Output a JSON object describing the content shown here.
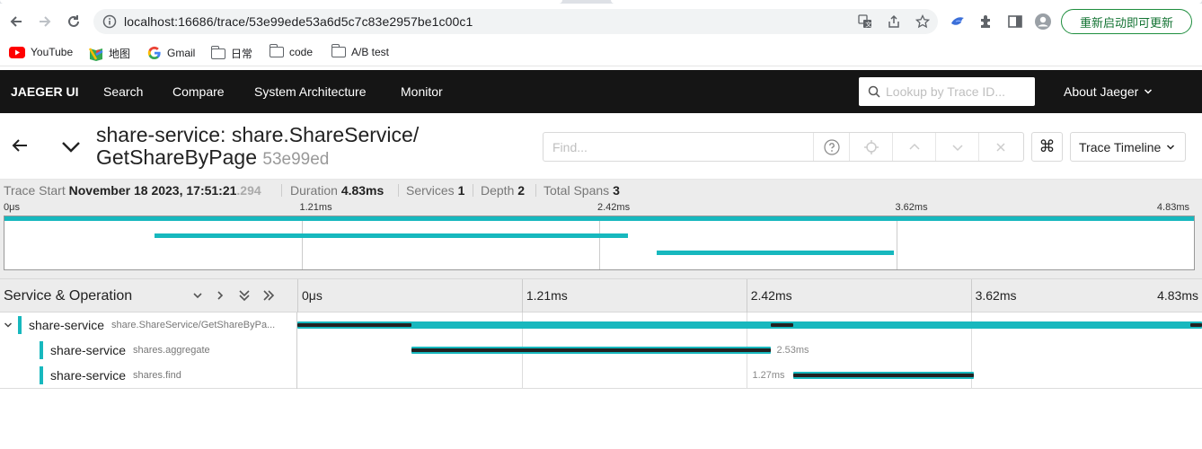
{
  "browser": {
    "url": "localhost:16686/trace/53e99ede53a6d5c7c83e2957be1c00c1",
    "restart_label": "重新启动即可更新",
    "bookmarks": [
      {
        "label": "YouTube",
        "icon": "youtube-icon"
      },
      {
        "label": "地图",
        "icon": "maps-icon"
      },
      {
        "label": "Gmail",
        "icon": "google-icon"
      },
      {
        "label": "日常",
        "icon": "folder-icon"
      },
      {
        "label": "code",
        "icon": "folder-icon"
      },
      {
        "label": "A/B test",
        "icon": "folder-icon"
      }
    ]
  },
  "nav": {
    "brand": "JAEGER UI",
    "items": [
      "Search",
      "Compare",
      "System Architecture",
      "Monitor"
    ],
    "lookup_placeholder": "Lookup by Trace ID...",
    "about": "About Jaeger"
  },
  "trace": {
    "title_line1": "share-service: share.ShareService/",
    "title_line2": "GetShareByPage",
    "trace_id_short": "53e99ed",
    "find_placeholder": "Find...",
    "view_mode": "Trace Timeline",
    "meta": {
      "start_label": "Trace Start",
      "start_value": "November 18 2023, 17:51:21",
      "start_ms": ".294",
      "duration_label": "Duration",
      "duration_value": "4.83ms",
      "services_label": "Services",
      "services_value": "1",
      "depth_label": "Depth",
      "depth_value": "2",
      "spans_label": "Total Spans",
      "spans_value": "3"
    },
    "ticks": [
      "0μs",
      "1.21ms",
      "2.42ms",
      "3.62ms",
      "4.83ms"
    ]
  },
  "span_table": {
    "header": "Service & Operation",
    "total_ms": 4.83,
    "spans": [
      {
        "service": "share-service",
        "operation": "share.ShareService/GetShareByPa...",
        "start_ms": 0.0,
        "duration_ms": 4.83,
        "duration_label": "",
        "depth": 0,
        "expandable": true
      },
      {
        "service": "share-service",
        "operation": "shares.aggregate",
        "start_ms": 0.61,
        "duration_ms": 1.92,
        "duration_label": "2.53ms",
        "depth": 1,
        "expandable": false
      },
      {
        "service": "share-service",
        "operation": "shares.find",
        "start_ms": 2.65,
        "duration_ms": 0.96,
        "duration_label": "1.27ms",
        "depth": 1,
        "expandable": false
      }
    ]
  },
  "colors": {
    "span": "#17b8be",
    "nav_bg": "#151515",
    "self_time": "#222222"
  }
}
